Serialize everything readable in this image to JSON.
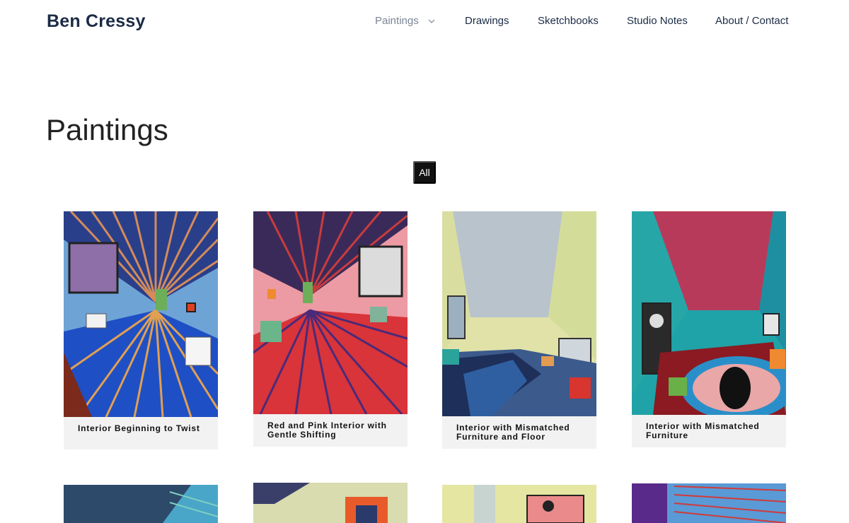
{
  "site": {
    "title": "Ben Cressy"
  },
  "nav": {
    "items": [
      {
        "label": "Paintings",
        "active": true,
        "has_dropdown": true
      },
      {
        "label": "Drawings"
      },
      {
        "label": "Sketchbooks"
      },
      {
        "label": "Studio Notes"
      },
      {
        "label": "About / Contact"
      }
    ],
    "dropdown_icon": "chevron-down-icon"
  },
  "page": {
    "title": "Paintings"
  },
  "filter": {
    "active_label": "All"
  },
  "gallery": [
    {
      "title": "Interior Beginning to Twist"
    },
    {
      "title": "Red and Pink Interior with Gentle Shifting"
    },
    {
      "title": "Interior with Mismatched Furniture and Floor"
    },
    {
      "title": "Interior with Mismatched Furniture"
    }
  ],
  "colors": {
    "brand": "#1b2b45",
    "nav_active": "#7a8594",
    "filter_bg": "#111111",
    "caption_bg": "#f2f2f2"
  }
}
